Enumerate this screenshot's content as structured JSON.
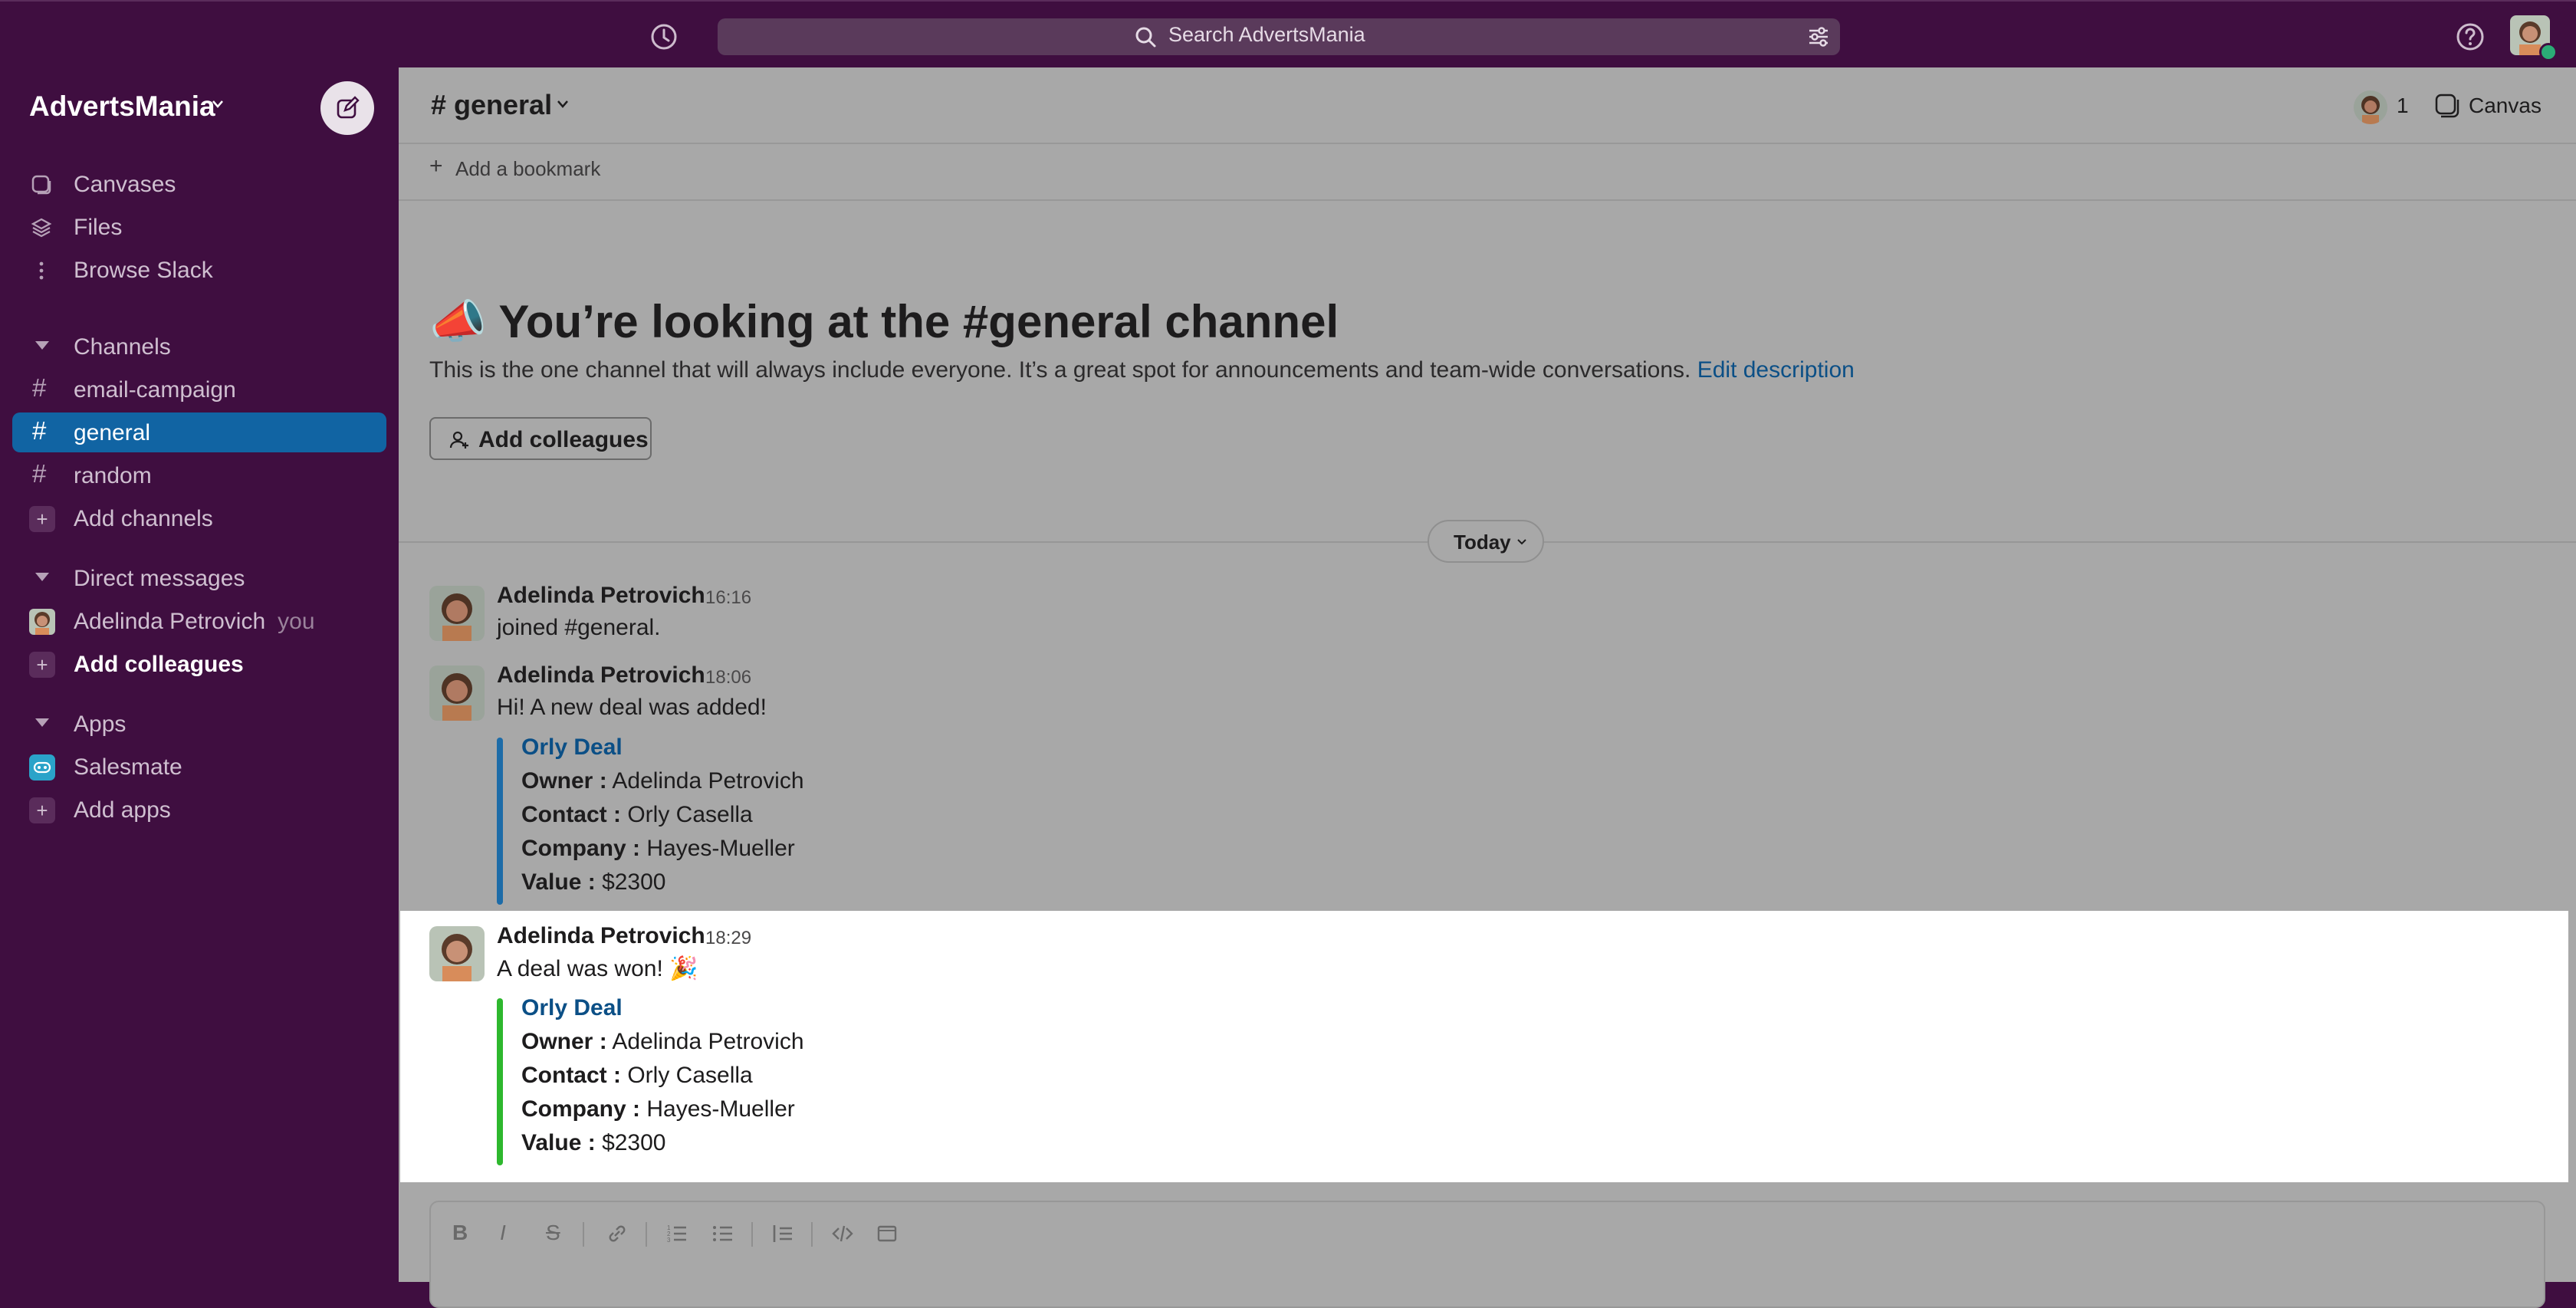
{
  "search": {
    "placeholder": "Search AdvertsMania"
  },
  "workspace": {
    "name": "AdvertsMania"
  },
  "sidebar": {
    "top_items": [
      {
        "label": "Canvases",
        "icon": "canvas-icon"
      },
      {
        "label": "Files",
        "icon": "files-icon"
      },
      {
        "label": "Browse Slack",
        "icon": "more-vertical-icon"
      }
    ],
    "channels_header": "Channels",
    "channels": [
      {
        "name": "email-campaign",
        "active": false
      },
      {
        "name": "general",
        "active": true
      },
      {
        "name": "random",
        "active": false
      }
    ],
    "add_channels": "Add channels",
    "dm_header": "Direct messages",
    "dm_user": "Adelinda Petrovich",
    "dm_you": "you",
    "add_colleagues": "Add colleagues",
    "apps_header": "Apps",
    "app_name": "Salesmate",
    "add_apps": "Add apps"
  },
  "channel": {
    "title": "# general",
    "member_count": "1",
    "canvas_label": "Canvas",
    "bookmark_label": "Add a bookmark"
  },
  "intro": {
    "title_emoji": "📣",
    "title_pre": "You’re looking at the",
    "title_hash": "#",
    "title_name": "general channel",
    "description": "This is the one channel that will always include everyone. It’s a great spot for announcements and team-wide conversations.",
    "edit_link": "Edit description",
    "add_button": "Add colleagues"
  },
  "divider_label": "Today",
  "messages": [
    {
      "author": "Adelinda Petrovich",
      "time": "16:16",
      "text": "joined #general."
    },
    {
      "author": "Adelinda Petrovich",
      "time": "18:06",
      "text": "Hi! A new deal was added!",
      "attachment": {
        "title": "Orly Deal",
        "color": "#1d6ca8",
        "fields": [
          {
            "key": "Owner :",
            "value": "Adelinda Petrovich"
          },
          {
            "key": "Contact :",
            "value": "Orly Casella"
          },
          {
            "key": "Company :",
            "value": "Hayes-Mueller"
          },
          {
            "key": "Value :",
            "value": "$2300"
          }
        ]
      }
    },
    {
      "author": "Adelinda Petrovich",
      "time": "18:29",
      "text": "A deal was won!",
      "emoji": "🎉",
      "attachment": {
        "title": "Orly Deal",
        "color": "#2eb82e",
        "fields": [
          {
            "key": "Owner :",
            "value": "Adelinda Petrovich"
          },
          {
            "key": "Contact :",
            "value": "Orly Casella"
          },
          {
            "key": "Company :",
            "value": "Hayes-Mueller"
          },
          {
            "key": "Value :",
            "value": "$2300"
          }
        ]
      }
    }
  ],
  "composer": {
    "tools": [
      "B",
      "I",
      "S"
    ]
  }
}
